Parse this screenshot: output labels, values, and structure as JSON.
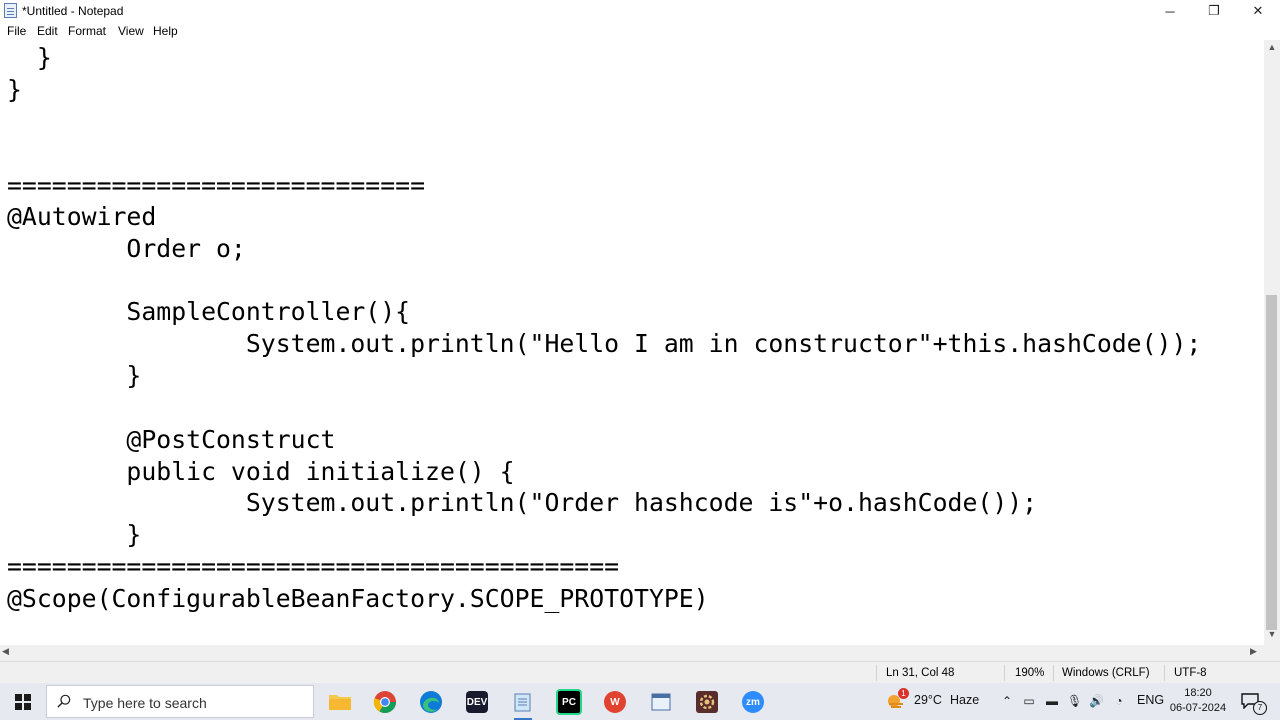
{
  "window": {
    "title": "*Untitled - Notepad",
    "minimize_glyph": "─",
    "maximize_glyph": "❐",
    "close_glyph": "✕"
  },
  "menu": {
    "file": "File",
    "edit": "Edit",
    "format": "Format",
    "view": "View",
    "help": "Help"
  },
  "editor": {
    "lines": [
      "  }",
      "}",
      "",
      "",
      "============================",
      "@Autowired",
      "        Order o;",
      "",
      "        SampleController(){",
      "                System.out.println(\"Hello I am in constructor\"+this.hashCode());",
      "        }",
      "",
      "        @PostConstruct",
      "        public void initialize() {",
      "                System.out.println(\"Order hashcode is\"+o.hashCode());",
      "        }",
      "=========================================",
      "@Scope(ConfigurableBeanFactory.SCOPE_PROTOTYPE)"
    ]
  },
  "status": {
    "position": "Ln 31, Col 48",
    "zoom": "190%",
    "line_ending": "Windows (CRLF)",
    "encoding": "UTF-8"
  },
  "taskbar": {
    "search_placeholder": "Type here to search",
    "apps": [
      "file-explorer",
      "chrome",
      "edge",
      "dev-tool",
      "notepad",
      "pycharm",
      "wps-office",
      "window-app",
      "settings-app",
      "zoom"
    ],
    "app_labels": {
      "dev": "DEV",
      "pycharm": "PC",
      "zoom": "zm",
      "wps": "W"
    },
    "weather_temp": "29°C",
    "weather_desc": "Haze",
    "weather_badge": "1",
    "language": "ENG",
    "time": "18:20",
    "date": "06-07-2024",
    "notification_count": "7"
  },
  "colors": {
    "taskbar_bg": "#e6eaf0",
    "chrome_red": "#db4437",
    "edge_blue": "#0f7bd8",
    "pycharm_green": "#21d789",
    "wps_red": "#e0432f",
    "zoom_blue": "#2d8cff"
  }
}
